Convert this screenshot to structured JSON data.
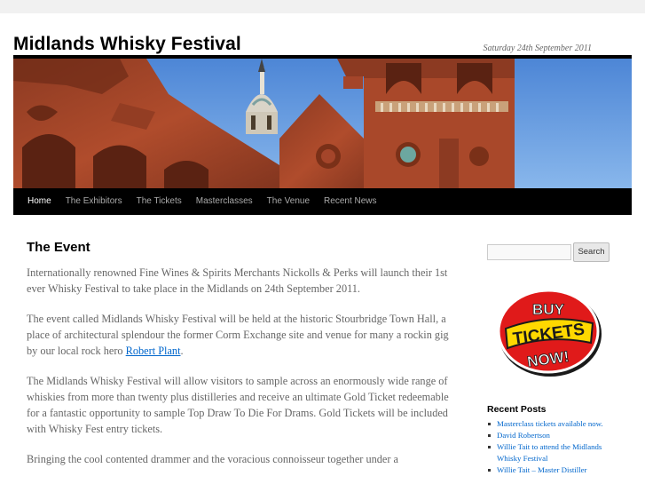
{
  "site": {
    "title": "Midlands Whisky Festival",
    "date": "Saturday 24th September 2011"
  },
  "nav": {
    "items": [
      {
        "label": "Home"
      },
      {
        "label": "The Exhibitors"
      },
      {
        "label": "The Tickets"
      },
      {
        "label": "Masterclasses"
      },
      {
        "label": "The Venue"
      },
      {
        "label": "Recent News"
      }
    ]
  },
  "article": {
    "heading": "The Event",
    "p1": "Internationally renowned Fine Wines & Spirits Merchants Nickolls & Perks will launch their 1st ever Whisky Festival to take place in the Midlands on 24th September 2011.",
    "p2_before": "The event called Midlands Whisky Festival will be held at the historic Stourbridge Town Hall, a place of architectural splendour the former Corm Exchange site and venue for many a rockin gig by our local rock hero ",
    "p2_link": "Robert Plant",
    "p2_after": ".",
    "p3": "The Midlands Whisky Festival will allow visitors to sample across an enormously wide range of whiskies from more than twenty plus distilleries and receive an ultimate Gold Ticket redeemable for a fantastic opportunity to sample Top Draw To Die For Drams. Gold Tickets will be included with Whisky Fest entry tickets.",
    "p4": "Bringing the cool contented drammer and the voracious connoisseur together under a"
  },
  "sidebar": {
    "search_button": "Search",
    "search_placeholder": "",
    "tickets_line1": "BUY",
    "tickets_line2": "TICKETS",
    "tickets_line3": "NOW!",
    "recent_title": "Recent Posts",
    "recent_posts": [
      "Masterclass tickets available now.",
      "David Robertson",
      "Willie Tait to attend the Midlands Whisky Festival",
      "Willie Tait – Master Distiller"
    ]
  },
  "colors": {
    "link": "#0066cc",
    "nav_bg": "#000000",
    "sky": "#6fa3e0",
    "brick": "#a4452a",
    "badge_red": "#e01a1a",
    "badge_yellow": "#ffd800"
  },
  "icons": {
    "bullet": "square-bullet-icon"
  }
}
